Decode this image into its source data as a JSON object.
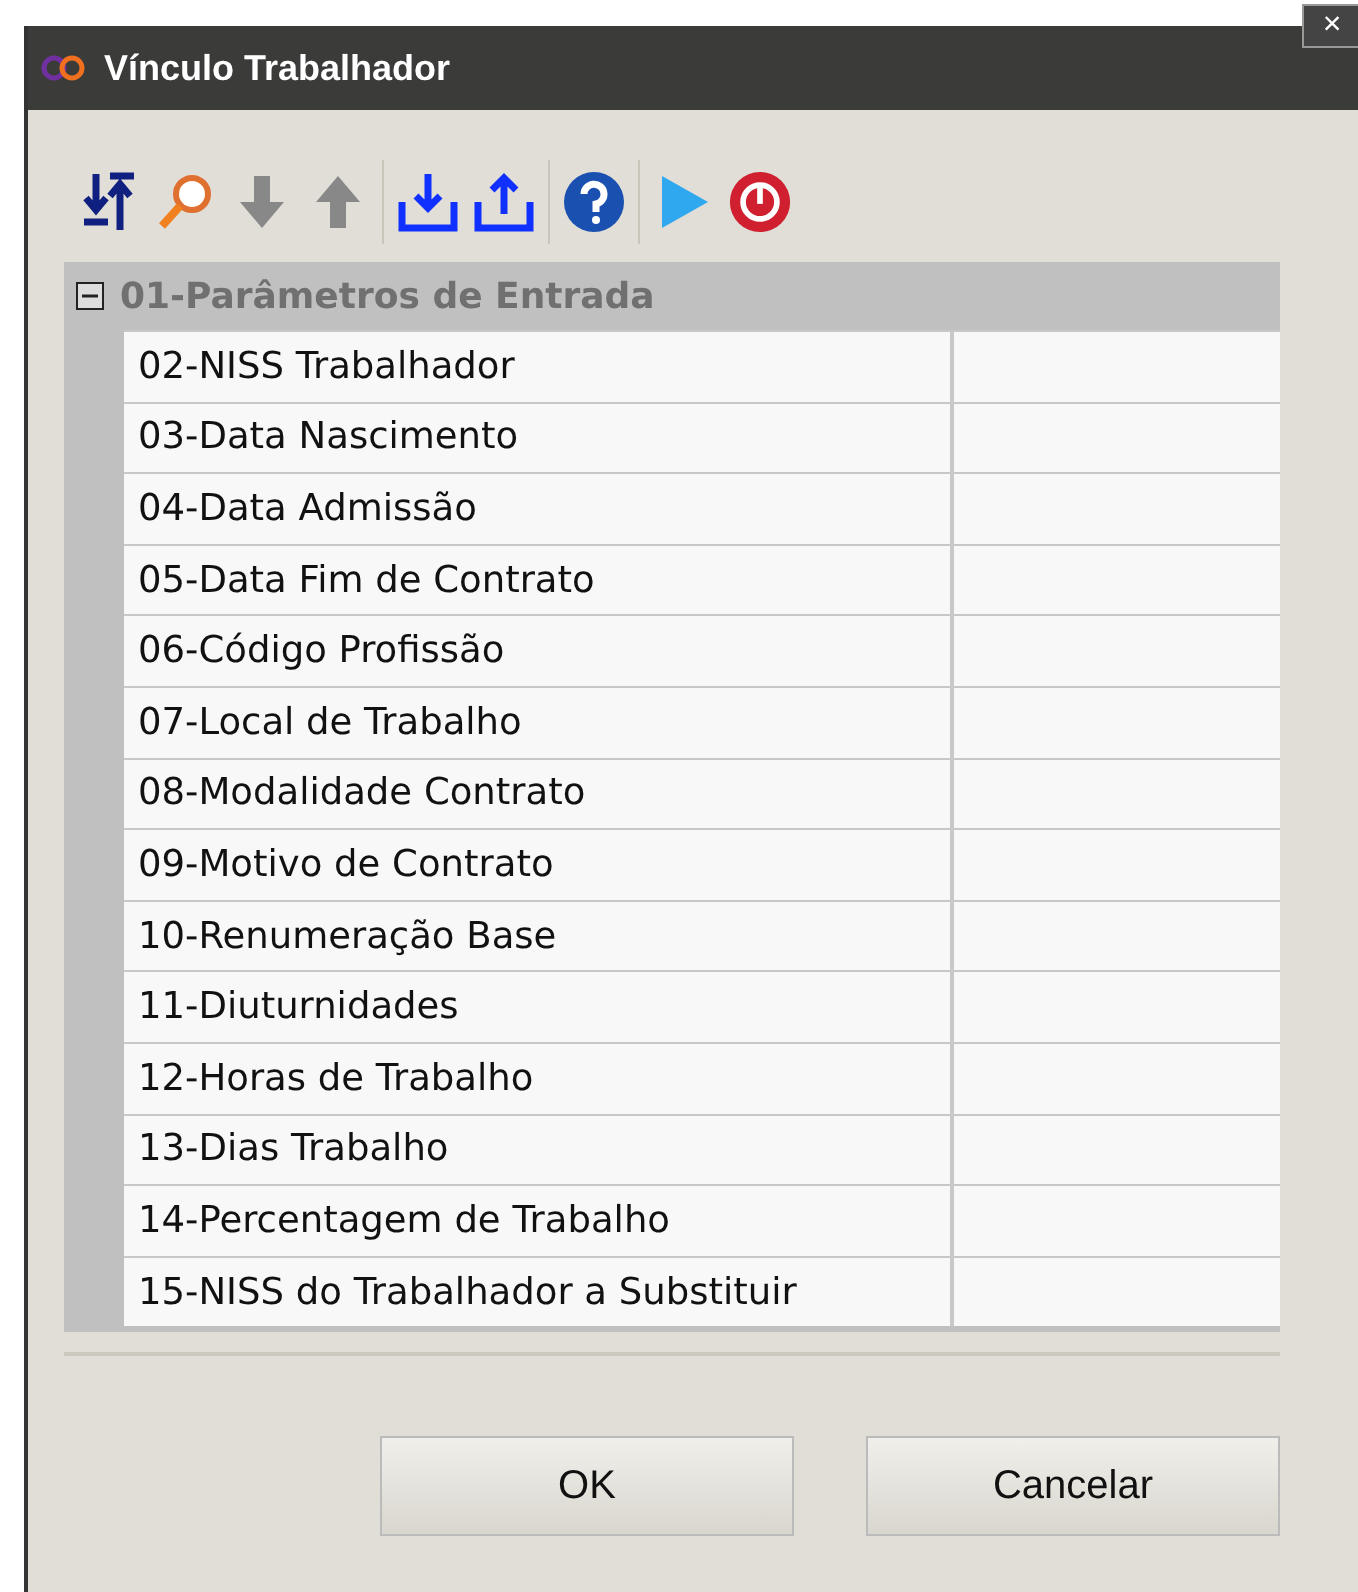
{
  "window": {
    "title": "Vínculo Trabalhador",
    "close": "×"
  },
  "toolbar": [
    {
      "kind": "sort",
      "disabled": false
    },
    {
      "kind": "search",
      "disabled": false
    },
    {
      "kind": "down",
      "disabled": true
    },
    {
      "kind": "up",
      "disabled": true
    },
    {
      "kind": "separator"
    },
    {
      "kind": "import",
      "disabled": false
    },
    {
      "kind": "export",
      "disabled": false
    },
    {
      "kind": "separator"
    },
    {
      "kind": "help",
      "disabled": false
    },
    {
      "kind": "separator"
    },
    {
      "kind": "run",
      "disabled": false
    },
    {
      "kind": "stop",
      "disabled": false
    }
  ],
  "grid": {
    "category": {
      "label": "01-Parâmetros de Entrada",
      "expanded": true
    },
    "rows": [
      {
        "label": "02-NISS Trabalhador"
      },
      {
        "label": "03-Data Nascimento"
      },
      {
        "label": "04-Data Admissão"
      },
      {
        "label": "05-Data Fim de Contrato"
      },
      {
        "label": "06-Código Profissão"
      },
      {
        "label": "07-Local de Trabalho"
      },
      {
        "label": "08-Modalidade Contrato"
      },
      {
        "label": "09-Motivo de Contrato"
      },
      {
        "label": "10-Renumeração Base"
      },
      {
        "label": "11-Diuturnidades"
      },
      {
        "label": "12-Horas de Trabalho"
      },
      {
        "label": "13-Dias Trabalho"
      },
      {
        "label": "14-Percentagem de Trabalho"
      },
      {
        "label": "15-NISS do Trabalhador a Substituir"
      }
    ]
  },
  "buttons": [
    {
      "label": "OK"
    },
    {
      "label": "Cancelar"
    }
  ]
}
